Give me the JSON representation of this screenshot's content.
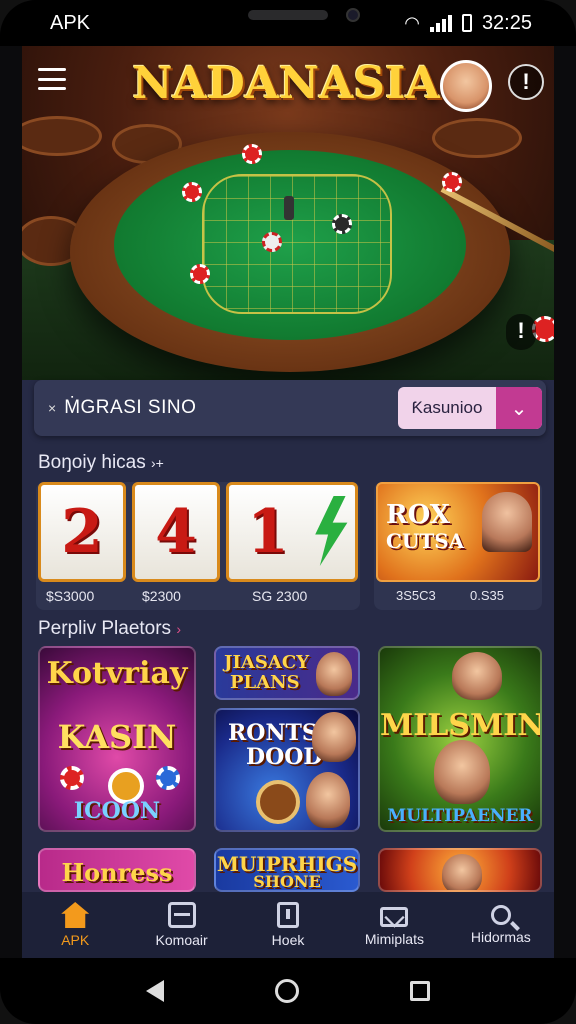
{
  "status_bar": {
    "carrier": "APK",
    "time": "32:25"
  },
  "hero": {
    "title": "NADANASIA",
    "alert_glyph": "!",
    "side_glyph": "!"
  },
  "promo_bar": {
    "close_glyph": "×",
    "text": "ṀGRASI SINO",
    "select_label": "Ƙasunioo"
  },
  "sections": {
    "bonus_title": "Boŋoiy hicas",
    "popular_title": "Perpliv Plaetors"
  },
  "slot_panel": {
    "reels": [
      "2",
      "4",
      "1"
    ],
    "values": [
      "$S3000",
      "$2300",
      "SG 2300"
    ]
  },
  "featured_game": {
    "title_line1": "ROX",
    "title_line2": "CUTSA",
    "meta_left": "3S5C3",
    "meta_right": "0.S35"
  },
  "games": [
    {
      "title_line1": "Kotvriay",
      "title_line2": "KASIN",
      "subtitle": "ICOON"
    },
    {
      "title_line1": "JIASACY",
      "title_line2": "PLANS"
    },
    {
      "title_line1": "RONTS",
      "title_line2": "DOOD"
    },
    {
      "title_line1": "MILSMIN",
      "subtitle": "MULTIPAENER"
    },
    {
      "title_line1": "Honress"
    },
    {
      "title_line1": "MUIPRHIGS",
      "title_line2": "SHONE"
    },
    {
      "title_line1": ""
    }
  ],
  "bottom_nav": [
    {
      "label": "APK",
      "icon": "home-icon",
      "active": true
    },
    {
      "label": "Komoair",
      "icon": "box-icon",
      "active": false
    },
    {
      "label": "Hoek",
      "icon": "doc-icon",
      "active": false
    },
    {
      "label": "Mimiplats",
      "icon": "mail-icon",
      "active": false
    },
    {
      "label": "Hidormas",
      "icon": "search-icon",
      "active": false
    }
  ],
  "colors": {
    "accent_orange": "#f39a1c",
    "accent_pink": "#c23a92",
    "panel": "#262a45",
    "logo_gold": "#ffd23a"
  }
}
